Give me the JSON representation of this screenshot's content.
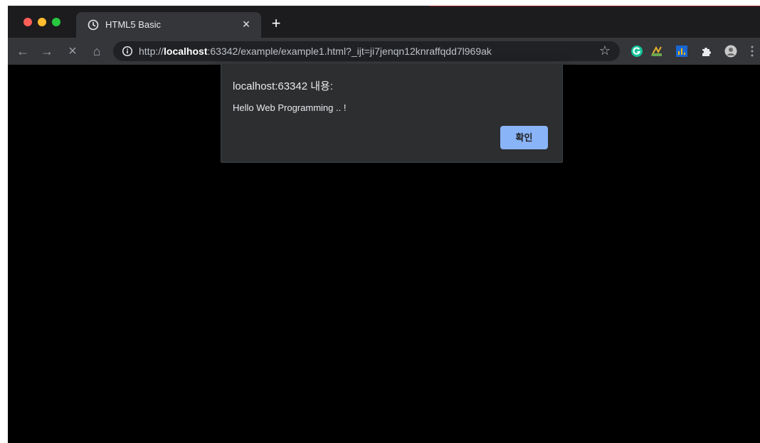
{
  "browser": {
    "tab": {
      "title": "HTML5 Basic",
      "favicon": "clock-favicon-icon",
      "close_label": "×"
    },
    "new_tab_label": "+",
    "toolbar": {
      "back_label": "←",
      "forward_label": "→",
      "stop_label": "×",
      "home_label": "⌂",
      "url_scheme": "http://",
      "url_host": "localhost",
      "url_rest": ":63342/example/example1.html?_ijt=ji7jenqn12knraffqdd7l969ak",
      "bookmark_label": "☆"
    },
    "extensions": [
      "grammarly-icon",
      "pdf-icon",
      "chart-icon",
      "puzzle-icon",
      "avatar-icon"
    ]
  },
  "alert_dialog": {
    "title": "localhost:63342 내용:",
    "message": "Hello Web Programming .. !",
    "ok_label": "확인"
  },
  "colors": {
    "page_background": "#000000",
    "chrome_dark": "#35363a",
    "dialog_background": "#2d2e30",
    "dialog_button": "#8ab4f8"
  }
}
